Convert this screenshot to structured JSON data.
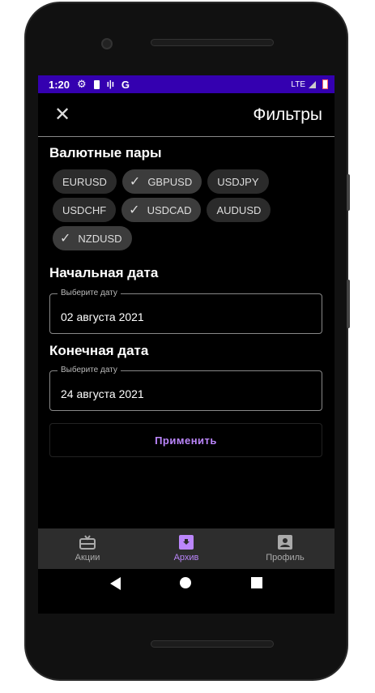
{
  "status": {
    "time": "1:20",
    "network": "LTE"
  },
  "header": {
    "title": "Фильтры"
  },
  "pairs": {
    "heading": "Валютные пары",
    "chips": [
      {
        "label": "EURUSD",
        "selected": false
      },
      {
        "label": "GBPUSD",
        "selected": true
      },
      {
        "label": "USDJPY",
        "selected": false
      },
      {
        "label": "USDCHF",
        "selected": false
      },
      {
        "label": "USDCAD",
        "selected": true
      },
      {
        "label": "AUDUSD",
        "selected": false
      },
      {
        "label": "NZDUSD",
        "selected": true
      }
    ]
  },
  "start": {
    "heading": "Начальная дата",
    "label": "Выберите дату",
    "value": "02 августа 2021"
  },
  "end": {
    "heading": "Конечная дата",
    "label": "Выберите дату",
    "value": "24 августа 2021"
  },
  "apply_label": "Применить",
  "nav": [
    {
      "label": "Акции",
      "icon": "gift-card-icon"
    },
    {
      "label": "Архив",
      "icon": "archive-icon",
      "active": true
    },
    {
      "label": "Профиль",
      "icon": "profile-icon"
    }
  ],
  "colors": {
    "accent": "#bb86fc",
    "statusbar": "#3400b0"
  }
}
